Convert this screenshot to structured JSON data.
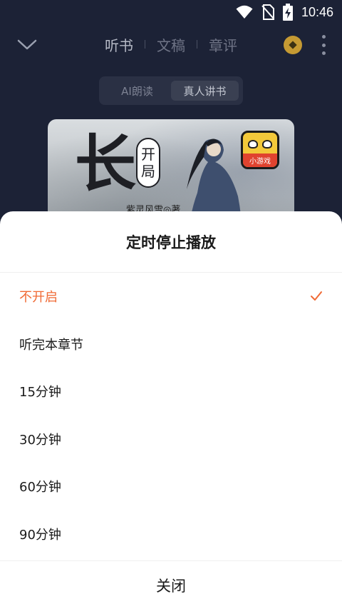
{
  "status_bar": {
    "time": "10:46",
    "icons": [
      "wifi-icon",
      "no-sim-icon",
      "battery-charging-icon"
    ]
  },
  "nav": {
    "back_icon": "chevron-down-icon",
    "tabs": [
      {
        "label": "听书",
        "active": true
      },
      {
        "label": "文稿",
        "active": false
      },
      {
        "label": "章评",
        "active": false
      }
    ],
    "coin_icon": "coin-icon",
    "more_icon": "more-vertical-icon"
  },
  "voice_toggle": {
    "options": [
      {
        "label": "AI朗读",
        "active": false
      },
      {
        "label": "真人讲书",
        "active": true
      }
    ]
  },
  "cover": {
    "title_char": "长",
    "badge_chars": [
      "开",
      "局"
    ],
    "author": "紫灵风雪◎著",
    "game_badge_label": "小游戏"
  },
  "sheet": {
    "title": "定时停止播放",
    "options": [
      {
        "label": "不开启",
        "selected": true
      },
      {
        "label": "听完本章节",
        "selected": false
      },
      {
        "label": "15分钟",
        "selected": false
      },
      {
        "label": "30分钟",
        "selected": false
      },
      {
        "label": "60分钟",
        "selected": false
      },
      {
        "label": "90分钟",
        "selected": false
      }
    ],
    "close_label": "关闭"
  },
  "colors": {
    "accent": "#f06a35",
    "background_dark": "#1c2236",
    "sheet_bg": "#ffffff"
  }
}
